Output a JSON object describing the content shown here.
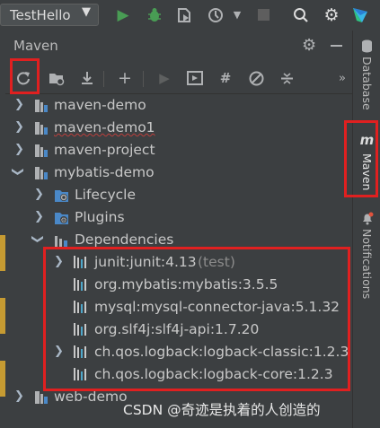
{
  "toolbar": {
    "run_config": "TestHello",
    "icons": [
      "run-icon",
      "debug-icon",
      "coverage-icon",
      "profile-icon",
      "stop-icon",
      "search-icon",
      "settings-icon",
      "toolbox-icon"
    ]
  },
  "panel": {
    "title": "Maven",
    "more_label": "»"
  },
  "tree": {
    "projects": [
      {
        "label": "maven-demo"
      },
      {
        "label": "maven-demo1"
      },
      {
        "label": "maven-project"
      },
      {
        "label": "mybatis-demo"
      }
    ],
    "children": [
      {
        "label": "Lifecycle"
      },
      {
        "label": "Plugins"
      },
      {
        "label": "Dependencies"
      }
    ],
    "dependencies": [
      {
        "label": "junit:junit:4.13",
        "hint": "(test)"
      },
      {
        "label": "org.mybatis:mybatis:3.5.5"
      },
      {
        "label": "mysql:mysql-connector-java:5.1.32"
      },
      {
        "label": "org.slf4j:slf4j-api:1.7.20"
      },
      {
        "label": "ch.qos.logback:logback-classic:1.2.3"
      },
      {
        "label": "ch.qos.logback:logback-core:1.2.3"
      }
    ],
    "last_project": {
      "label": "web-demo"
    }
  },
  "sidebar": {
    "database": "Database",
    "maven": "Maven",
    "notifications": "Notifications"
  },
  "watermark": "CSDN @奇迹是执着的人创造的",
  "colors": {
    "background": "#3c3f41",
    "highlight_box": "#e02020",
    "run_green": "#499c54",
    "folder_blue": "#4a88c7"
  }
}
